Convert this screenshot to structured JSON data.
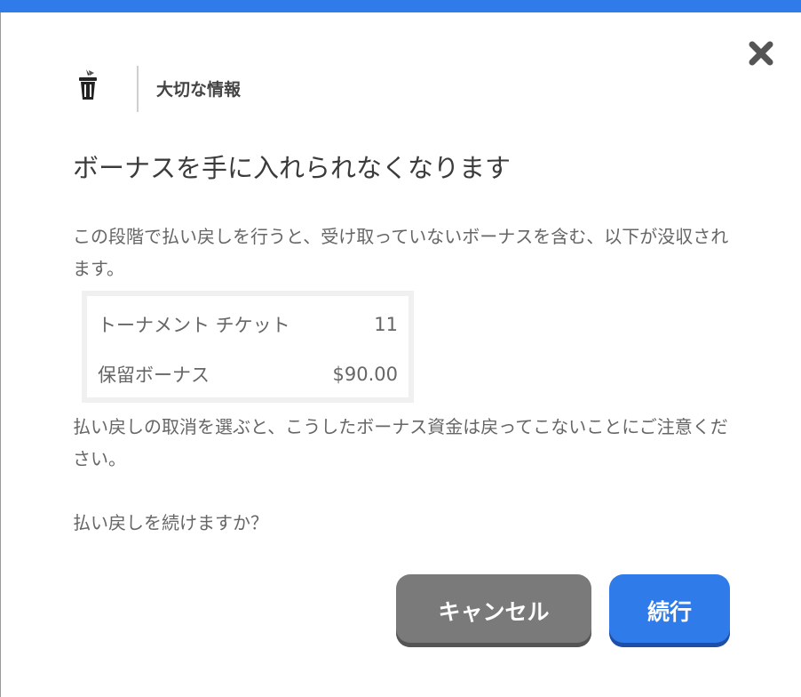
{
  "dialog": {
    "label": "大切な情報",
    "headline": "ボーナスを手に入れられなくなります",
    "intro": "この段階で払い戻しを行うと、受け取っていないボーナスを含む、以下が没収されます。",
    "items": [
      {
        "name": "トーナメント チケット",
        "value": "11"
      },
      {
        "name": "保留ボーナス",
        "value": "$90.00"
      }
    ],
    "warning": "払い戻しの取消を選ぶと、こうしたボーナス資金は戻ってこないことにご注意ください。",
    "question": "払い戻しを続けますか？",
    "cancel_label": "キャンセル",
    "continue_label": "続行"
  },
  "icons": {
    "header_icon": "trash-can-icon",
    "close_icon": "close-icon"
  },
  "colors": {
    "accent": "#2f7bea",
    "cancel_button": "#7a7a7a",
    "text": "#666666"
  }
}
